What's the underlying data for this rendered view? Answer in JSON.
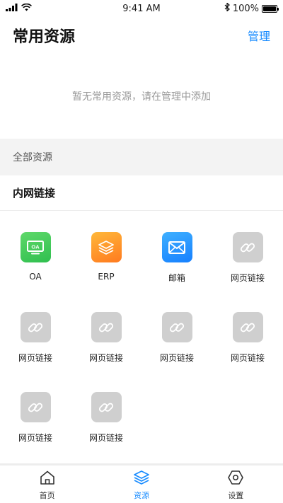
{
  "status_bar": {
    "time": "9:41 AM",
    "battery_text": "100%",
    "icons": [
      "signal-icon",
      "wifi-icon",
      "bluetooth-icon",
      "battery-icon"
    ]
  },
  "header": {
    "title": "常用资源",
    "manage_label": "管理"
  },
  "empty_tip": "暂无常用资源，请在管理中添加",
  "all_resources": {
    "title": "全部资源",
    "section_title": "内网链接",
    "items": [
      {
        "label": "OA",
        "icon": "oa-icon",
        "color": "#3cc65a"
      },
      {
        "label": "ERP",
        "icon": "erp-layers-icon",
        "color": "#ff8c28"
      },
      {
        "label": "邮箱",
        "icon": "mail-icon",
        "color": "#1f8fff"
      },
      {
        "label": "网页链接",
        "icon": "link-icon",
        "color": "#cfcfcf"
      },
      {
        "label": "网页链接",
        "icon": "link-icon",
        "color": "#cfcfcf"
      },
      {
        "label": "网页链接",
        "icon": "link-icon",
        "color": "#cfcfcf"
      },
      {
        "label": "网页链接",
        "icon": "link-icon",
        "color": "#cfcfcf"
      },
      {
        "label": "网页链接",
        "icon": "link-icon",
        "color": "#cfcfcf"
      },
      {
        "label": "网页链接",
        "icon": "link-icon",
        "color": "#cfcfcf"
      },
      {
        "label": "网页链接",
        "icon": "link-icon",
        "color": "#cfcfcf"
      }
    ]
  },
  "tab_bar": {
    "tabs": [
      {
        "label": "首页",
        "icon": "home-icon",
        "active": false
      },
      {
        "label": "资源",
        "icon": "layers-icon",
        "active": true
      },
      {
        "label": "设置",
        "icon": "settings-hexagon-icon",
        "active": false
      }
    ]
  },
  "colors": {
    "accent": "#1a8cff",
    "section_bg": "#f3f3f3",
    "muted_text": "#999999"
  }
}
